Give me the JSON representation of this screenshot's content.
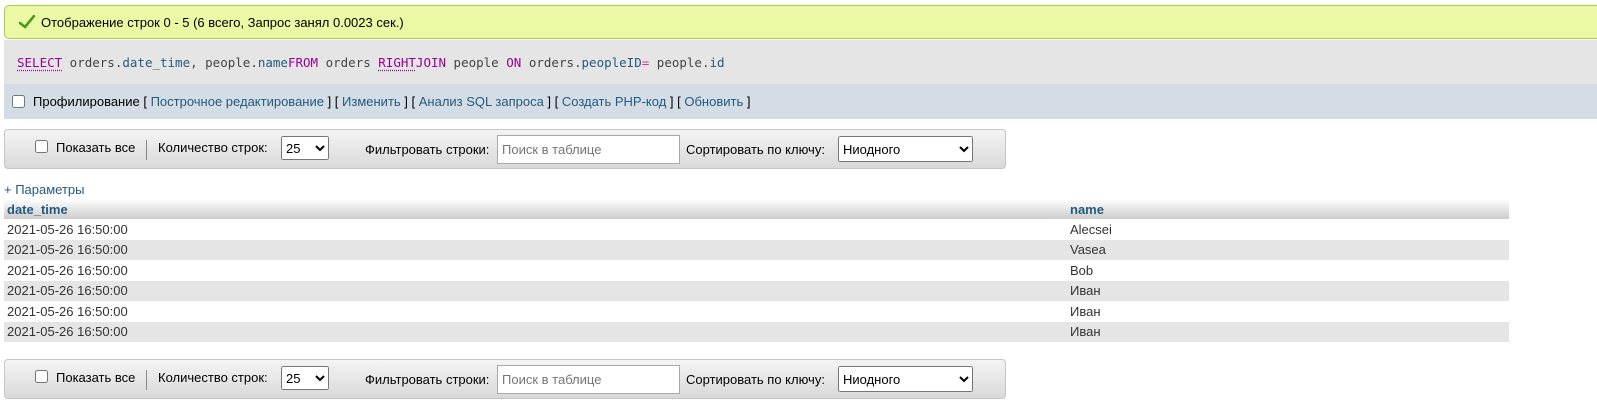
{
  "success": {
    "message": "Отображение строк 0 - 5 (6 всего, Запрос занял 0.0023 сек.)",
    "icon": "check-icon"
  },
  "sql": {
    "tokens": {
      "select": "SELECT",
      "t1": " orders.",
      "c1": "date_time",
      "t2": ", people.",
      "c2": "name",
      "from": "FROM",
      "t3": " orders ",
      "right": "RIGHT",
      "join": "JOIN",
      "t4": " people ",
      "on": "ON",
      "t5": " orders.",
      "c3": "peopleID",
      "eq": "=",
      "t6": " people.",
      "c4": "id"
    }
  },
  "profile": {
    "label": "Профилирование",
    "links": [
      "Построчное редактирование",
      "Изменить",
      "Анализ SQL запроса",
      "Создать PHP-код",
      "Обновить"
    ]
  },
  "navbar": {
    "show_all": "Показать все",
    "rows_label": "Количество строк:",
    "rows_value": "25",
    "filter_label": "Фильтровать строки:",
    "search_placeholder": "Поиск в таблице",
    "sort_label": "Сортировать по ключу:",
    "sort_value": "Ниодного"
  },
  "params_link": "+ Параметры",
  "table": {
    "columns": [
      "date_time",
      "name"
    ],
    "rows": [
      [
        "2021-05-26 16:50:00",
        "Alecsei"
      ],
      [
        "2021-05-26 16:50:00",
        "Vasea"
      ],
      [
        "2021-05-26 16:50:00",
        "Bob"
      ],
      [
        "2021-05-26 16:50:00",
        "Иван"
      ],
      [
        "2021-05-26 16:50:00",
        "Иван"
      ],
      [
        "2021-05-26 16:50:00",
        "Иван"
      ]
    ]
  },
  "colors": {
    "success_bg": "#ebf8a4",
    "link": "#235a81",
    "sql_keyword": "#990099"
  }
}
